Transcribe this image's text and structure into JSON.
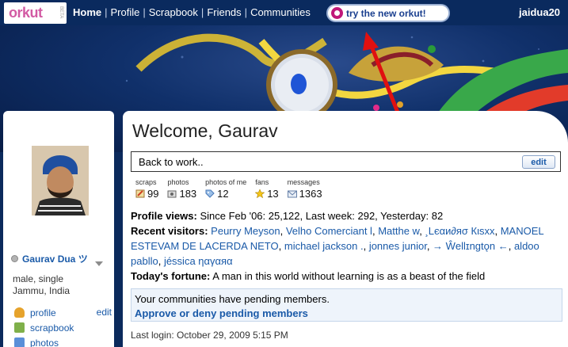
{
  "nav": {
    "logo": "orkut",
    "logo_badge": "BETA",
    "items": [
      "Home",
      "Profile",
      "Scrapbook",
      "Friends",
      "Communities"
    ],
    "try_new": "try the new orkut!",
    "username": "jaidua20"
  },
  "sidebar": {
    "name": "Gaurav Dua",
    "name_suffix": "ツ",
    "details": [
      "male, single",
      "Jammu, India"
    ],
    "edit_label": "edit",
    "links": [
      {
        "label": "profile",
        "icon": "profile-icon"
      },
      {
        "label": "scrapbook",
        "icon": "scrapbook-icon"
      },
      {
        "label": "photos",
        "icon": "photos-icon"
      }
    ]
  },
  "main": {
    "welcome": "Welcome, Gaurav",
    "status_message": "Back to work..",
    "status_edit": "edit",
    "stats": [
      {
        "label": "scraps",
        "value": "99",
        "icon": "pencil-icon"
      },
      {
        "label": "photos",
        "value": "183",
        "icon": "camera-icon"
      },
      {
        "label": "photos of me",
        "value": "12",
        "icon": "tag-icon"
      },
      {
        "label": "fans",
        "value": "13",
        "icon": "star-icon"
      },
      {
        "label": "messages",
        "value": "1363",
        "icon": "envelope-icon"
      }
    ],
    "profile_views_label": "Profile views:",
    "profile_views_text": "Since Feb '06: 25,122, Last week: 292, Yesterday: 82",
    "recent_visitors_label": "Recent visitors:",
    "visitors": [
      "Peurry Meyson",
      "Velho Comerciant l",
      "Matthe w",
      "¸Lєαи∂яσ Кιѕхх",
      "MANOEL ESTEVAM DE LACERDA NETO",
      "michael jackson .",
      "jonnes junior",
      "→ Ŵellɪngtǫn ←",
      "aldoo pabllo",
      "jéssica ηαγαяα"
    ],
    "fortune_label": "Today's fortune:",
    "fortune_text": "A man in this world without learning is as a beast of the field",
    "pending_text": "Your communities have pending members.",
    "pending_action": "Approve or deny pending members",
    "last_login": "Last login: October 29, 2009 5:15 PM"
  },
  "colors": {
    "nav_bg": "#0a2a5e",
    "link": "#1a5aa8",
    "logo_pink": "#d25aa3",
    "try_icon": "#c0187a",
    "arrow": "#e01010"
  }
}
